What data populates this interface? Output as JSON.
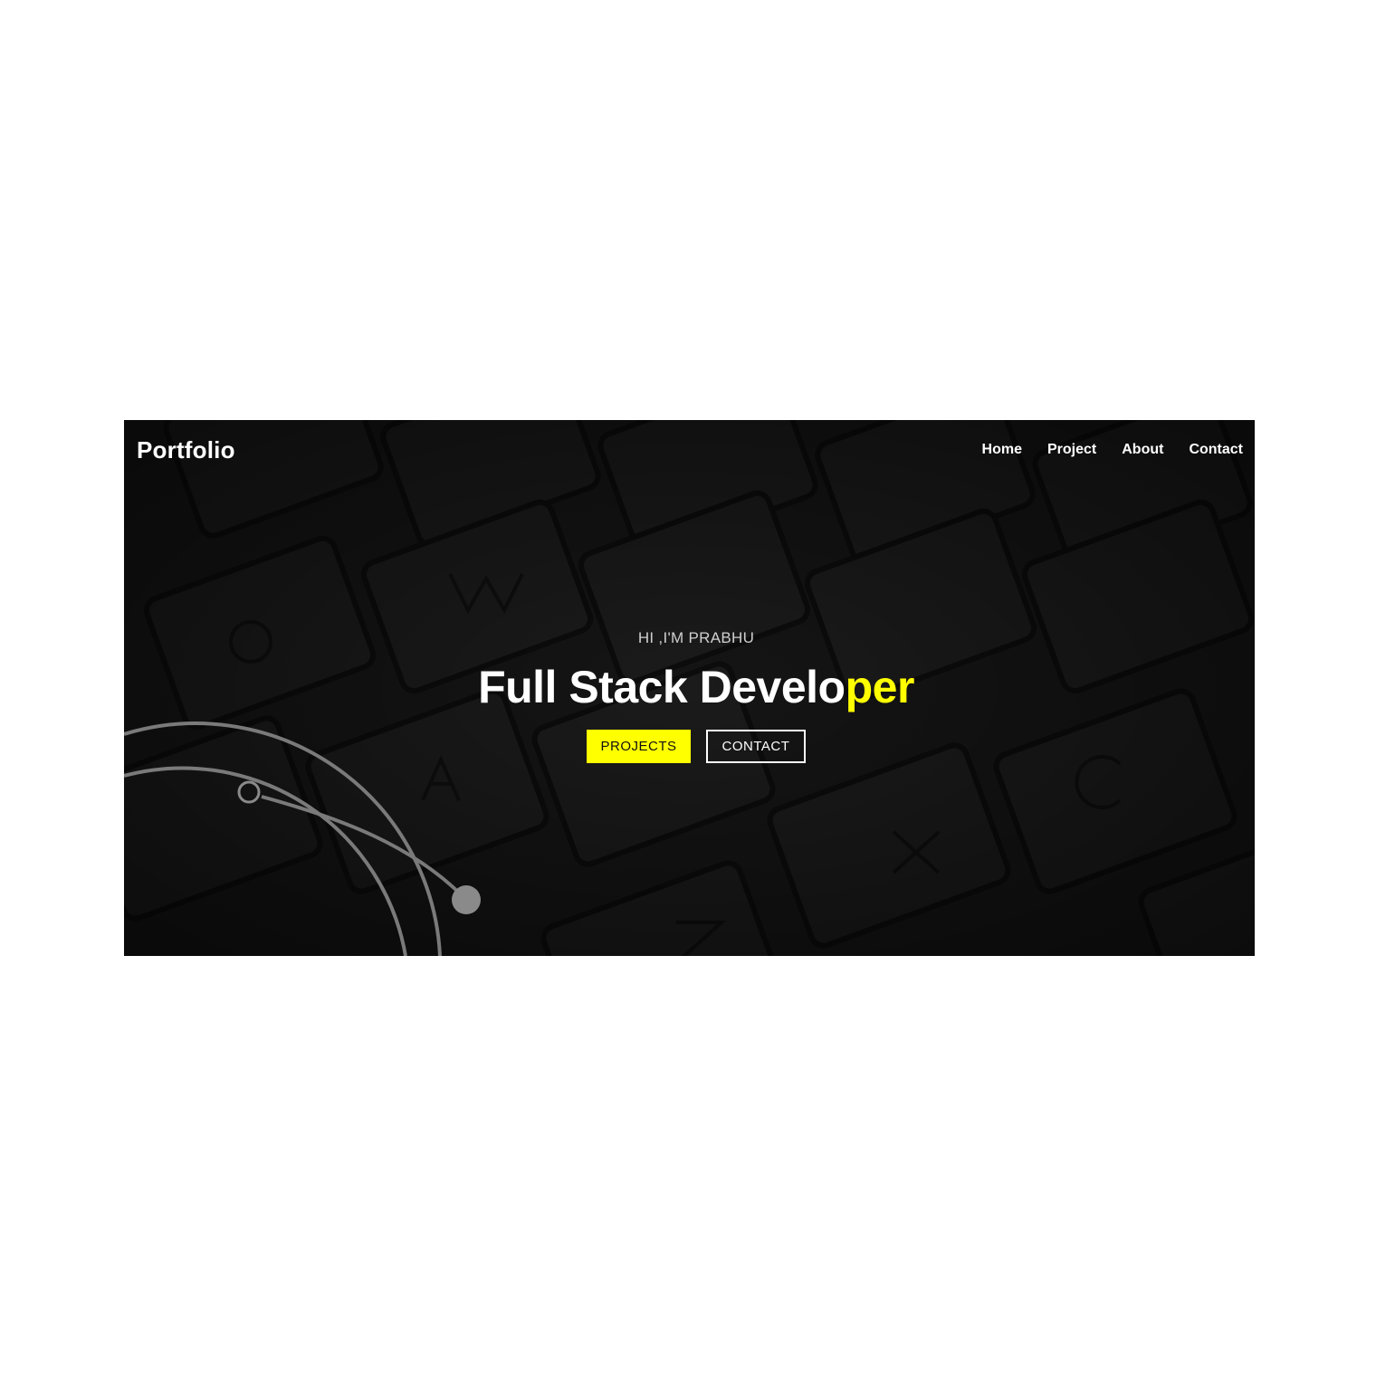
{
  "header": {
    "brand": "Portfolio",
    "nav": [
      {
        "label": "Home"
      },
      {
        "label": "Project"
      },
      {
        "label": "About"
      },
      {
        "label": "Contact"
      }
    ]
  },
  "hero": {
    "greeting": "HI ,I'M PRABHU",
    "headline_main": "Full Stack Develo",
    "headline_highlight": "per",
    "primary_button": "PROJECTS",
    "secondary_button": "CONTACT",
    "background": "keyboard-photo",
    "decoration": "orbit-arcs"
  },
  "colors": {
    "accent": "#ffff00",
    "hero_bg": "#141414",
    "text": "#ffffff",
    "page_bg": "#ffffff"
  }
}
